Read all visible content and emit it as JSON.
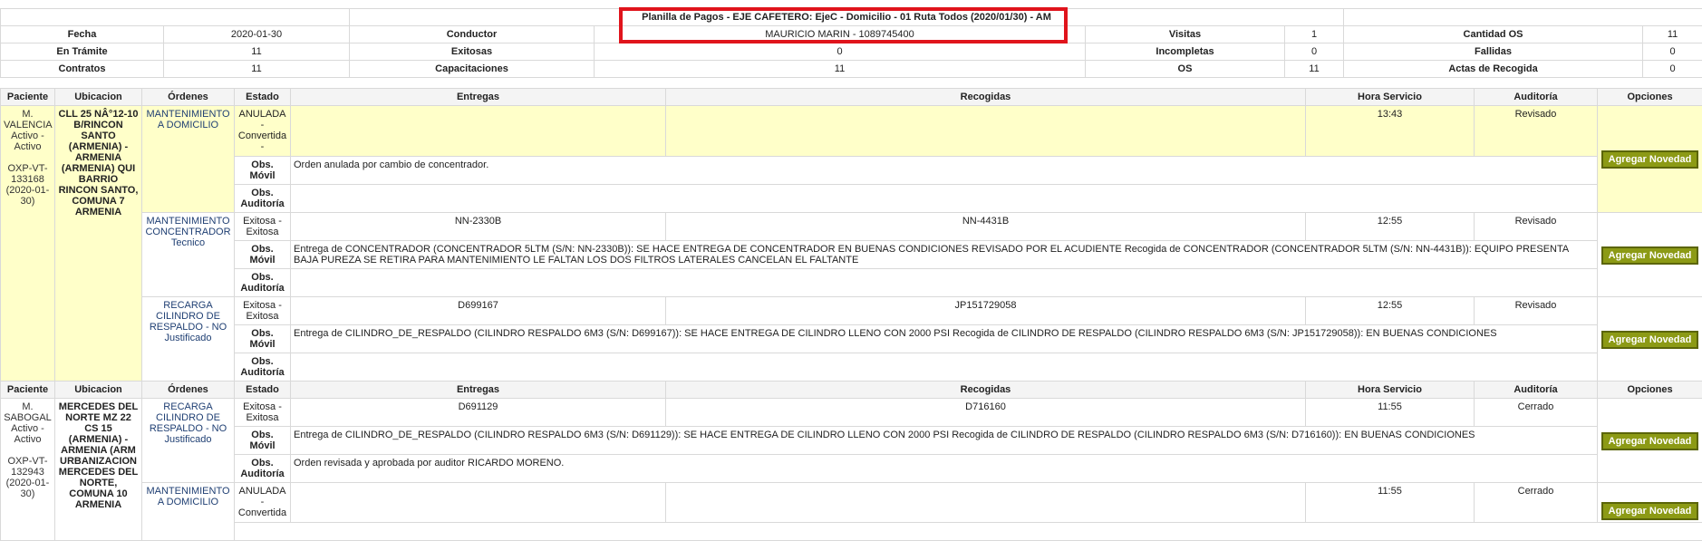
{
  "summary": {
    "title": "Planilla de Pagos - EJE CAFETERO: EjeC - Domicilio - 01 Ruta Todos (2020/01/30) - AM",
    "rows": [
      {
        "l1": "Fecha",
        "v1": "2020-01-30",
        "l2": "Conductor",
        "v2": "MAURICIO MARIN - 1089745400",
        "l3": "Visitas",
        "v3": "1",
        "l4": "Cantidad OS",
        "v4": "11"
      },
      {
        "l1": "En Trámite",
        "v1": "11",
        "l2": "Exitosas",
        "v2": "0",
        "l3": "Incompletas",
        "v3": "0",
        "l4": "Fallidas",
        "v4": "0"
      },
      {
        "l1": "Contratos",
        "v1": "11",
        "l2": "Capacitaciones",
        "v2": "11",
        "l3": "OS",
        "v3": "11",
        "l4": "Actas de Recogida",
        "v4": "0"
      }
    ]
  },
  "columns": [
    "Paciente",
    "Ubicacion",
    "Órdenes",
    "Estado",
    "Entregas",
    "Recogidas",
    "Hora Servicio",
    "Auditoría",
    "Opciones"
  ],
  "obs_movil_label": "Obs. Móvil",
  "obs_auditoria_label": "Obs. Auditoría",
  "add_label": "Agregar Novedad",
  "patients": [
    {
      "name": "M. VALENCIA",
      "status": "Activo - Activo",
      "code": "OXP-VT-133168 (2020-01-30)",
      "ubicacion": "CLL 25 NÂ°12-10 B/RINCON SANTO (ARMENIA) - ARMENIA (ARMENIA) QUI BARRIO RINCON SANTO, COMUNA 7 ARMENIA",
      "orders": [
        {
          "orden": "MANTENIMIENTO A DOMICILIO",
          "estado": "ANULADA - Convertida -",
          "entrega": "",
          "recogida": "",
          "hora": "13:43",
          "auditoria": "Revisado",
          "obs_movil": "Orden anulada por cambio de concentrador.",
          "obs_auditoria": ""
        },
        {
          "orden": "MANTENIMIENTO CONCENTRADOR Tecnico",
          "estado": "Exitosa - Exitosa",
          "entrega": "NN-2330B",
          "recogida": "NN-4431B",
          "hora": "12:55",
          "auditoria": "Revisado",
          "obs_movil": "Entrega de CONCENTRADOR (CONCENTRADOR 5LTM (S/N: NN-2330B)): SE HACE ENTREGA DE CONCENTRADOR EN BUENAS CONDICIONES REVISADO POR EL ACUDIENTE Recogida de CONCENTRADOR (CONCENTRADOR 5LTM (S/N: NN-4431B)): EQUIPO PRESENTA BAJA PUREZA SE RETIRA PARA MANTENIMIENTO LE FALTAN LOS DOS FILTROS LATERALES CANCELAN EL FALTANTE",
          "obs_auditoria": ""
        },
        {
          "orden": "RECARGA CILINDRO DE RESPALDO - NO Justificado",
          "estado": "Exitosa - Exitosa",
          "entrega": "D699167",
          "recogida": "JP151729058",
          "hora": "12:55",
          "auditoria": "Revisado",
          "obs_movil": "Entrega de CILINDRO_DE_RESPALDO (CILINDRO RESPALDO 6M3 (S/N: D699167)): SE HACE ENTREGA DE CILINDRO LLENO CON 2000 PSI Recogida de CILINDRO DE RESPALDO (CILINDRO RESPALDO 6M3 (S/N: JP151729058)): EN BUENAS CONDICIONES",
          "obs_auditoria": ""
        }
      ]
    },
    {
      "name": "M. SABOGAL",
      "status": "Activo - Activo",
      "code": "OXP-VT-132943 (2020-01-30)",
      "ubicacion": "MERCEDES DEL NORTE MZ 22 CS 15 (ARMENIA) - ARMENIA (ARM URBANIZACION MERCEDES DEL NORTE, COMUNA 10 ARMENIA",
      "orders": [
        {
          "orden": "RECARGA CILINDRO DE RESPALDO - NO Justificado",
          "estado": "Exitosa - Exitosa",
          "entrega": "D691129",
          "recogida": "D716160",
          "hora": "11:55",
          "auditoria": "Cerrado",
          "obs_movil": "Entrega de CILINDRO_DE_RESPALDO (CILINDRO RESPALDO 6M3 (S/N: D691129)): SE HACE ENTREGA DE CILINDRO LLENO CON 2000 PSI Recogida de CILINDRO DE RESPALDO (CILINDRO RESPALDO 6M3 (S/N: D716160)): EN BUENAS CONDICIONES",
          "obs_auditoria": "Orden revisada y aprobada por auditor RICARDO MORENO."
        },
        {
          "orden": "MANTENIMIENTO A DOMICILIO",
          "estado": "ANULADA - Convertida",
          "entrega": "",
          "recogida": "",
          "hora": "11:55",
          "auditoria": "Cerrado"
        }
      ]
    }
  ]
}
